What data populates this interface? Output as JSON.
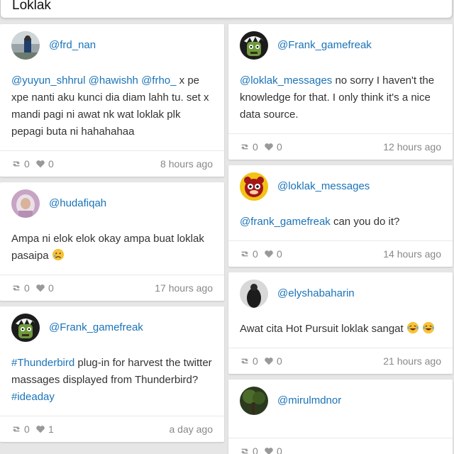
{
  "search": {
    "query": "Loklak"
  },
  "left": [
    {
      "handle": "@frd_nan",
      "text_parts": [
        {
          "t": "@yuyun_shhrul",
          "link": true
        },
        {
          "t": " ",
          "link": false
        },
        {
          "t": "@hawishh",
          "link": true
        },
        {
          "t": " ",
          "link": false
        },
        {
          "t": "@frho_",
          "link": true
        },
        {
          "t": " x pe xpe nanti aku kunci dia diam lahh tu. set x mandi pagi ni awat nk wat loklak plk pepagi buta ni hahahahaa",
          "link": false
        }
      ],
      "retweets": "0",
      "likes": "0",
      "time": "8 hours ago",
      "avatar": "figure"
    },
    {
      "handle": "@hudafiqah",
      "text_parts": [
        {
          "t": "Ampa ni elok elok okay ampa buat loklak pasaipa ",
          "link": false
        }
      ],
      "emoji": [
        "sad"
      ],
      "retweets": "0",
      "likes": "0",
      "time": "17 hours ago",
      "avatar": "girl"
    },
    {
      "handle": "@Frank_gamefreak",
      "text_parts": [
        {
          "t": "#Thunderbird",
          "link": true
        },
        {
          "t": " plug-in for harvest the twitter massages displayed from Thunderbird? ",
          "link": false
        },
        {
          "t": "#ideaday",
          "link": true
        }
      ],
      "retweets": "0",
      "likes": "1",
      "time": "a day ago",
      "avatar": "zombie"
    }
  ],
  "right": [
    {
      "handle": "@Frank_gamefreak",
      "text_parts": [
        {
          "t": "@loklak_messages",
          "link": true
        },
        {
          "t": " no sorry I haven't the knowledge for that. I only think it's a nice data source.",
          "link": false
        }
      ],
      "retweets": "0",
      "likes": "0",
      "time": "12 hours ago",
      "avatar": "zombie"
    },
    {
      "handle": "@loklak_messages",
      "text_parts": [
        {
          "t": "@frank_gamefreak",
          "link": true
        },
        {
          "t": " can you do it?",
          "link": false
        }
      ],
      "retweets": "0",
      "likes": "0",
      "time": "14 hours ago",
      "avatar": "squirrel"
    },
    {
      "handle": "@elyshabaharin",
      "text_parts": [
        {
          "t": "Awat cita Hot Pursuit loklak sangat ",
          "link": false
        }
      ],
      "emoji": [
        "laugh",
        "laugh"
      ],
      "retweets": "0",
      "likes": "0",
      "time": "21 hours ago",
      "avatar": "dark"
    },
    {
      "handle": "@mirulmdnor",
      "text_parts": [
        {
          "t": "",
          "link": false
        }
      ],
      "retweets": "0",
      "likes": "0",
      "time": "",
      "avatar": "tree"
    }
  ],
  "colors": {
    "link": "#1a73b8",
    "muted": "#888888",
    "background": "#e6e6e6"
  }
}
